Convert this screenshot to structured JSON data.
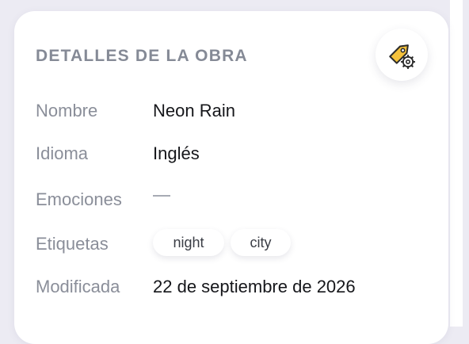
{
  "panel": {
    "title": "DETALLES DE LA OBRA",
    "settings_icon": "tag-settings-icon",
    "rows": {
      "name": {
        "label": "Nombre",
        "value": "Neon Rain"
      },
      "language": {
        "label": "Idioma",
        "value": "Inglés"
      },
      "emotions": {
        "label": "Emociones",
        "value": "—"
      },
      "tags": {
        "label": "Etiquetas",
        "items": [
          "night",
          "city"
        ]
      },
      "modified": {
        "label": "Modificada",
        "value": "22 de septiembre de 2026"
      }
    }
  },
  "colors": {
    "background": "#ecebf3",
    "card": "#ffffff",
    "label": "#8a8e99",
    "value": "#15161a",
    "tag_icon": "#f5c23c"
  }
}
